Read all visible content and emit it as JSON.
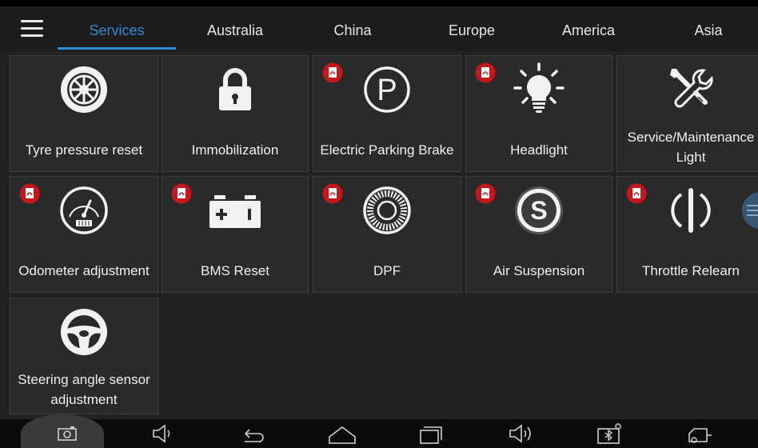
{
  "tabs": [
    {
      "label": "Services",
      "active": true
    },
    {
      "label": "Australia",
      "active": false
    },
    {
      "label": "China",
      "active": false
    },
    {
      "label": "Europe",
      "active": false
    },
    {
      "label": "America",
      "active": false
    },
    {
      "label": "Asia",
      "active": false
    }
  ],
  "functions": [
    {
      "label": "Tyre pressure reset",
      "icon": "tyre-icon",
      "pdf": false
    },
    {
      "label": "Immobilization",
      "icon": "padlock-icon",
      "pdf": false
    },
    {
      "label": "Electric Parking Brake",
      "icon": "parking-p-icon",
      "pdf": true
    },
    {
      "label": "Headlight",
      "icon": "bulb-icon",
      "pdf": true
    },
    {
      "label": "Service/Maintenance Light",
      "label_line1": "Service/Maintenance",
      "label_line2": "Light",
      "icon": "wrench-screwdriver-icon",
      "pdf": false
    },
    {
      "label": "Odometer adjustment",
      "icon": "odometer-gauge-icon",
      "pdf": true
    },
    {
      "label": "BMS Reset",
      "icon": "battery-icon",
      "pdf": true
    },
    {
      "label": "DPF",
      "icon": "dpf-filter-icon",
      "pdf": true
    },
    {
      "label": "Air Suspension",
      "icon": "suspension-s-icon",
      "pdf": true
    },
    {
      "label": "Throttle Relearn",
      "icon": "throttle-icon",
      "pdf": true
    },
    {
      "label": "Steering angle sensor adjustment",
      "label_line1": "Steering angle sensor",
      "label_line2": "adjustment",
      "icon": "steering-wheel-icon",
      "pdf": false
    }
  ],
  "navbar": {
    "buttons": [
      "screenshot-icon",
      "volume-down-icon",
      "back-icon",
      "home-icon",
      "recent-apps-icon",
      "volume-up-icon",
      "bluetooth-vci-icon",
      "vci-vehicle-icon"
    ]
  },
  "colors": {
    "accent": "#2b8cd6",
    "background": "#232323",
    "tile": "#2a2a2a",
    "pdf_badge": "#c4161c"
  }
}
